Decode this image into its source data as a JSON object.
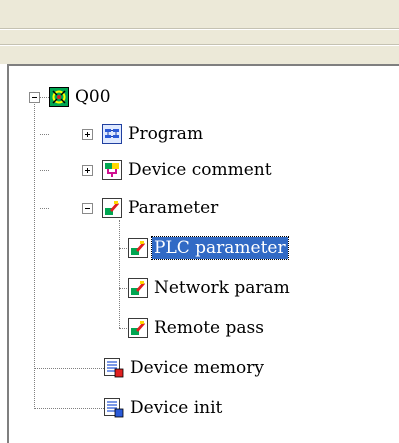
{
  "project_tree": {
    "root": {
      "label": "Q00",
      "icon": "plc-project-icon",
      "state": "expanded"
    },
    "nodes": [
      {
        "label": "Program",
        "icon": "program-icon",
        "state": "collapsed"
      },
      {
        "label": "Device comment",
        "icon": "device-comment-icon",
        "state": "collapsed"
      },
      {
        "label": "Parameter",
        "icon": "parameter-icon",
        "state": "expanded",
        "children": [
          {
            "label": "PLC parameter",
            "icon": "parameter-icon",
            "selected": true
          },
          {
            "label": "Network param",
            "icon": "parameter-icon"
          },
          {
            "label": "Remote pass",
            "icon": "parameter-icon"
          }
        ]
      },
      {
        "label": "Device memory",
        "icon": "device-memory-icon"
      },
      {
        "label": "Device init",
        "icon": "device-init-icon"
      }
    ]
  },
  "colors": {
    "selection": "#316ac5",
    "window_chrome": "#ece9d8"
  }
}
